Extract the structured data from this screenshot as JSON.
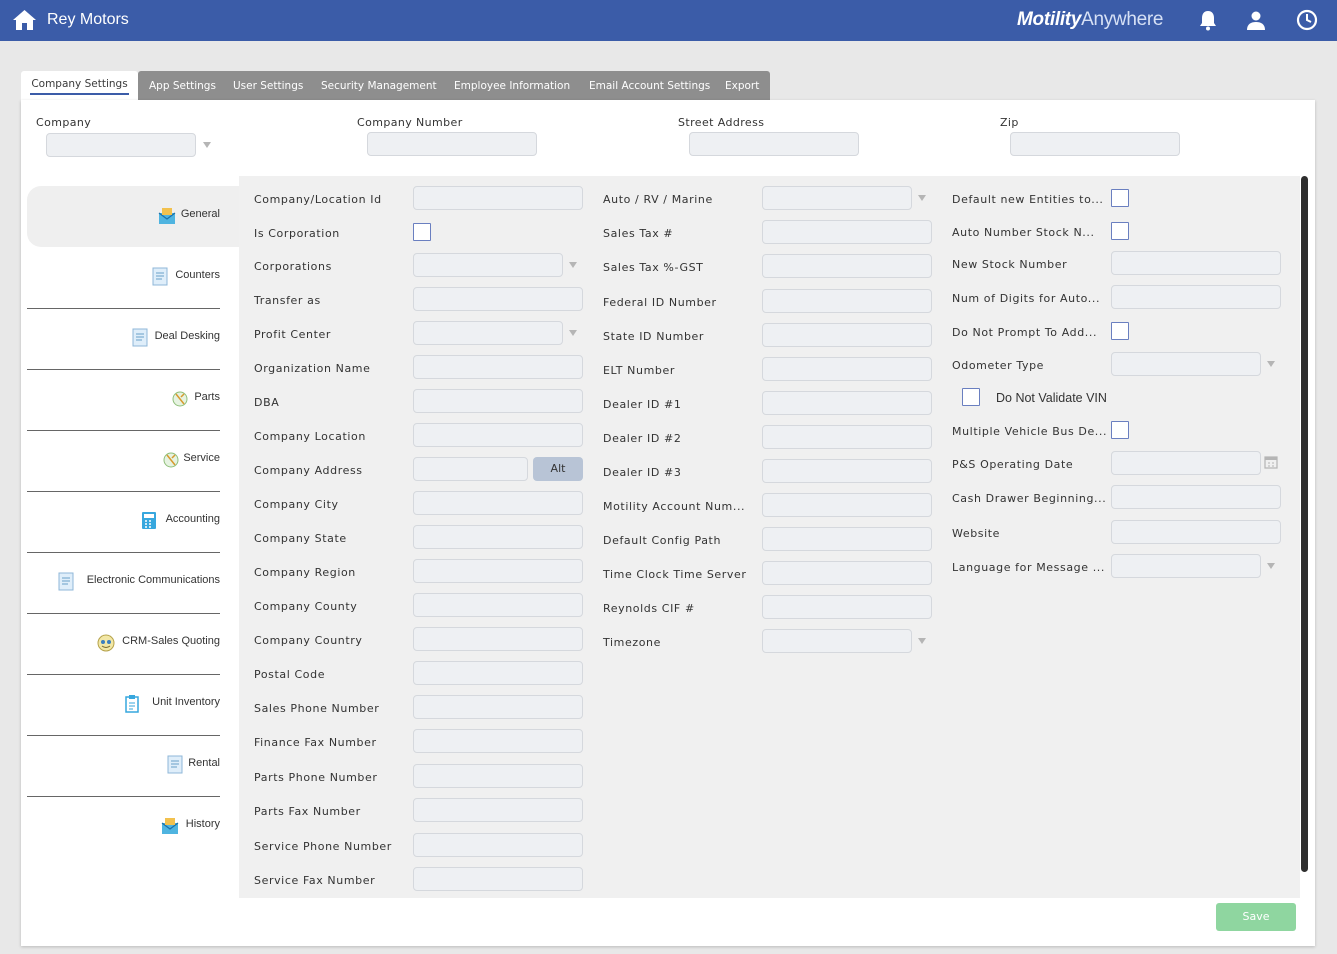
{
  "app": {
    "title": "Rey Motors",
    "brand_bold": "Motility",
    "brand_light": "Anywhere"
  },
  "tabs": [
    {
      "label": "Company Settings",
      "active": true
    },
    {
      "label": "App Settings"
    },
    {
      "label": "User Settings"
    },
    {
      "label": "Security Management"
    },
    {
      "label": "Employee Information"
    },
    {
      "label": "Email Account Settings"
    },
    {
      "label": "Export"
    }
  ],
  "header_fields": {
    "company": "Company",
    "company_number": "Company Number",
    "street_address": "Street Address",
    "zip": "Zip"
  },
  "sidebar": [
    {
      "label": "General",
      "icon": "general-icon"
    },
    {
      "label": "Counters",
      "icon": "counters-icon"
    },
    {
      "label": "Deal Desking",
      "icon": "deal-desking-icon"
    },
    {
      "label": "Parts",
      "icon": "parts-icon"
    },
    {
      "label": "Service",
      "icon": "service-icon"
    },
    {
      "label": "Accounting",
      "icon": "calculator-icon"
    },
    {
      "label": "Electronic Communications",
      "icon": "document-icon"
    },
    {
      "label": "CRM-Sales Quoting",
      "icon": "crm-icon"
    },
    {
      "label": "Unit Inventory",
      "icon": "clipboard-icon"
    },
    {
      "label": "Rental",
      "icon": "document-icon"
    },
    {
      "label": "History",
      "icon": "history-icon"
    }
  ],
  "col1": [
    "Company/Location Id",
    "Is Corporation",
    "Corporations",
    "Transfer as",
    "Profit Center",
    "Organization Name",
    "DBA",
    "Company Location",
    "Company Address",
    "Company City",
    "Company State",
    "Company Region",
    "Company County",
    "Company Country",
    "Postal Code",
    "Sales Phone Number",
    "Finance Fax Number",
    "Parts Phone Number",
    "Parts Fax Number",
    "Service Phone Number",
    "Service Fax Number"
  ],
  "col2": [
    "Auto / RV / Marine",
    "Sales Tax #",
    "Sales Tax %-GST",
    "Federal ID Number",
    "State ID Number",
    "ELT Number",
    "Dealer ID #1",
    "Dealer ID #2",
    "Dealer ID #3",
    "Motility Account Num...",
    "Default Config Path",
    "Time Clock Time Server",
    "Reynolds CIF #",
    "Timezone"
  ],
  "col3": [
    "Default new Entities to...",
    "Auto Number Stock N...",
    "New Stock Number",
    "Num of Digits for Auto...",
    "Do Not Prompt To Add...",
    "Odometer Type",
    "Do Not Validate VIN",
    "Multiple Vehicle Bus De...",
    "P&S Operating Date",
    "Cash Drawer Beginning...",
    "Website",
    "Language for Message ..."
  ],
  "buttons": {
    "alt": "Alt",
    "save": "Save"
  }
}
